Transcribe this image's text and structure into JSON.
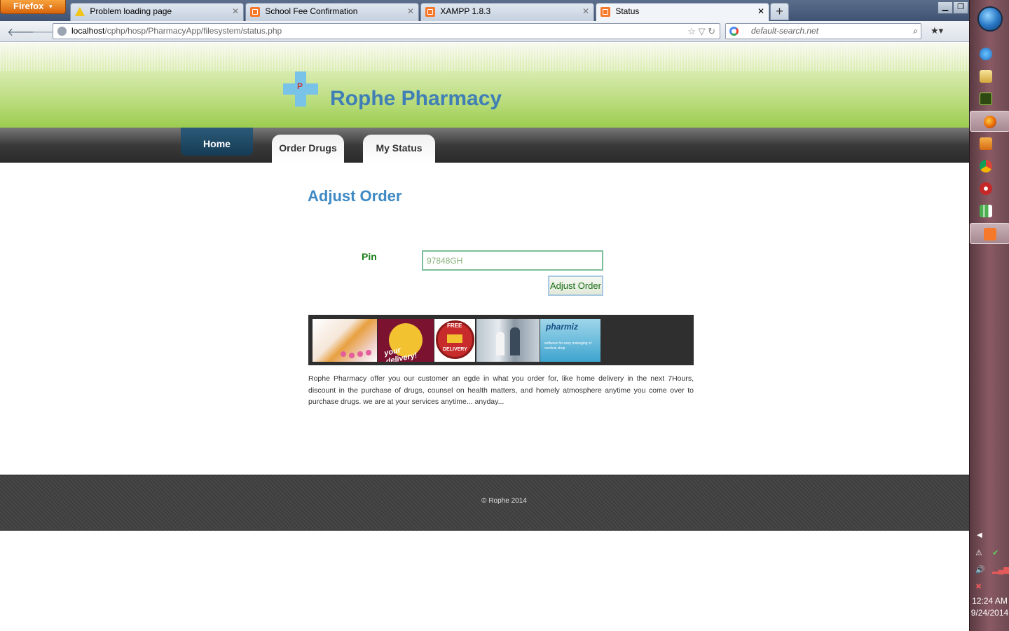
{
  "browser": {
    "menu_label": "Firefox",
    "tabs": [
      {
        "title": "Problem loading page",
        "icon": "warning-icon"
      },
      {
        "title": "School Fee Confirmation",
        "icon": "xampp-icon"
      },
      {
        "title": "XAMPP 1.8.3",
        "icon": "xampp-icon"
      },
      {
        "title": "Status",
        "icon": "xampp-icon",
        "active": true
      }
    ],
    "url_host": "localhost",
    "url_path": "/cphp/hosp/PharmacyApp/filesystem/status.php",
    "search_placeholder": "default-search.net"
  },
  "site": {
    "title": "Rophe Pharmacy",
    "logo_letter": "P",
    "nav": [
      {
        "label": "Home",
        "active": true
      },
      {
        "label": "Order Drugs"
      },
      {
        "label": "My Status"
      }
    ]
  },
  "main": {
    "heading": "Adjust Order",
    "pin_label": "Pin",
    "pin_value": "97848GH",
    "submit_label": "Adjust Order",
    "banner": {
      "delivery_text": "your delivery!",
      "free_delivery_top": "FREE",
      "free_delivery_bottom": "DELIVERY",
      "pharmiz_name": "pharmiz",
      "pharmiz_tagline": "software for easy managing of medical shop"
    },
    "description": "Rophe Pharmacy offer you our customer an egde in what you order for, like home delivery in the next 7Hours, discount in the purchase of drugs, counsel on health matters, and homely atmosphere anytime you come over to purchase drugs. we are at your services anytime... anyday..."
  },
  "footer": {
    "copyright": "© Rophe 2014"
  },
  "taskbar": {
    "time": "12:24 AM",
    "date": "9/24/2014"
  },
  "colors": {
    "title_blue": "#3f7fb6",
    "heading_blue": "#3f8ac4",
    "label_green": "#1a7f1a",
    "header_green": "#9ccc50",
    "nav_active": "#153b55"
  }
}
